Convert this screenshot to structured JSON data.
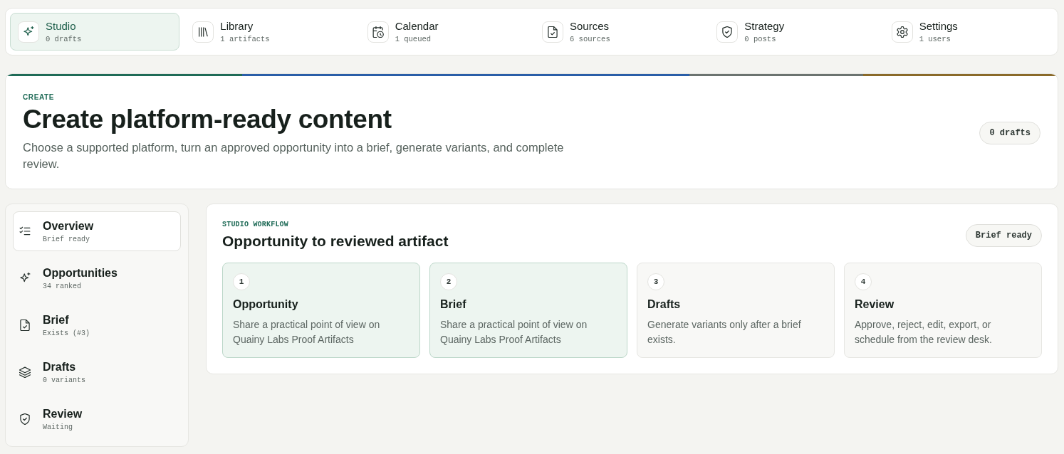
{
  "nav_tabs": [
    {
      "label": "Studio",
      "meta": "0 drafts",
      "selected": true
    },
    {
      "label": "Library",
      "meta": "1 artifacts",
      "selected": false
    },
    {
      "label": "Calendar",
      "meta": "1 queued",
      "selected": false
    },
    {
      "label": "Sources",
      "meta": "6 sources",
      "selected": false
    },
    {
      "label": "Strategy",
      "meta": "0 posts",
      "selected": false
    },
    {
      "label": "Settings",
      "meta": "1 users",
      "selected": false
    }
  ],
  "hero": {
    "eyebrow": "CREATE",
    "title": "Create platform-ready content",
    "description": "Choose a supported platform, turn an approved opportunity into a brief, generate variants, and complete review.",
    "badge": "0 drafts"
  },
  "sidebar": {
    "items": [
      {
        "label": "Overview",
        "meta": "Brief ready",
        "selected": true
      },
      {
        "label": "Opportunities",
        "meta": "34 ranked",
        "selected": false
      },
      {
        "label": "Brief",
        "meta": "Exists (#3)",
        "selected": false
      },
      {
        "label": "Drafts",
        "meta": "0 variants",
        "selected": false
      },
      {
        "label": "Review",
        "meta": "Waiting",
        "selected": false
      }
    ]
  },
  "workflow": {
    "eyebrow": "STUDIO WORKFLOW",
    "title": "Opportunity to reviewed artifact",
    "badge": "Brief ready",
    "steps": [
      {
        "number": "1",
        "title": "Opportunity",
        "description": "Share a practical point of view on Quainy Labs Proof Artifacts",
        "complete": true
      },
      {
        "number": "2",
        "title": "Brief",
        "description": "Share a practical point of view on Quainy Labs Proof Artifacts",
        "complete": true
      },
      {
        "number": "3",
        "title": "Drafts",
        "description": "Generate variants only after a brief exists.",
        "complete": false
      },
      {
        "number": "4",
        "title": "Review",
        "description": "Approve, reject, edit, export, or schedule from the review desk.",
        "complete": false
      }
    ]
  }
}
